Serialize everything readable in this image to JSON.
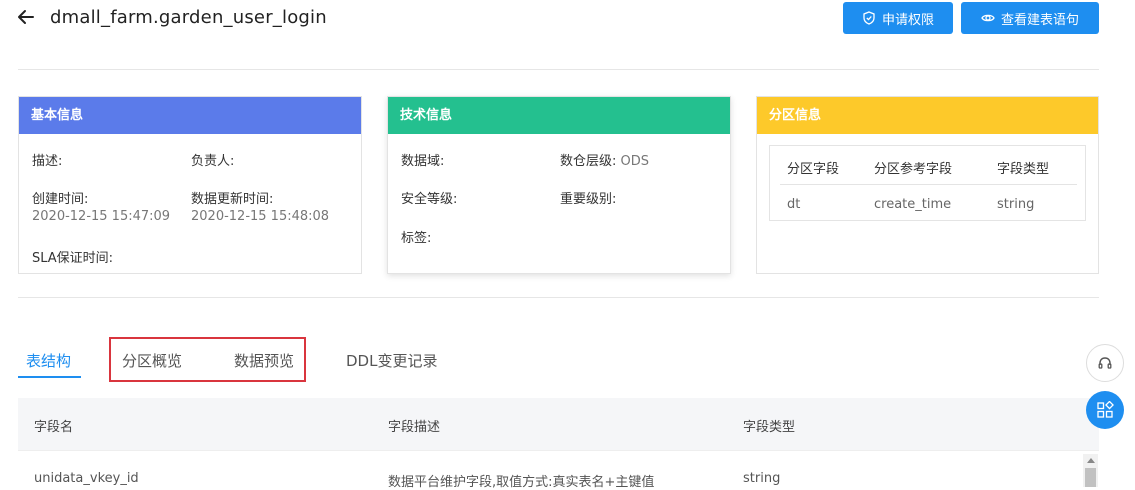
{
  "header": {
    "title": "dmall_farm.garden_user_login",
    "apply_permission_label": "申请权限",
    "view_ddl_label": "查看建表语句"
  },
  "basic_info": {
    "title": "基本信息",
    "description_label": "描述:",
    "owner_label": "负责人:",
    "created_label": "创建时间:",
    "created_value": "2020-12-15 15:47:09",
    "updated_label": "数据更新时间:",
    "updated_value": "2020-12-15 15:48:08",
    "sla_label": "SLA保证时间:"
  },
  "tech_info": {
    "title": "技术信息",
    "domain_label": "数据域:",
    "layer_label": "数仓层级:",
    "layer_value": "ODS",
    "security_label": "安全等级:",
    "importance_label": "重要级别:",
    "tags_label": "标签:"
  },
  "partition_info": {
    "title": "分区信息",
    "columns": [
      "分区字段",
      "分区参考字段",
      "字段类型"
    ],
    "rows": [
      [
        "dt",
        "create_time",
        "string"
      ]
    ]
  },
  "tabs": [
    {
      "label": "表结构",
      "active": true
    },
    {
      "label": "分区概览",
      "active": false
    },
    {
      "label": "数据预览",
      "active": false
    },
    {
      "label": "DDL变更记录",
      "active": false
    }
  ],
  "schema_table": {
    "columns": [
      "字段名",
      "字段描述",
      "字段类型"
    ],
    "rows": [
      [
        "unidata_vkey_id",
        "数据平台维护字段,取值方式:真实表名+主键值",
        "string"
      ]
    ]
  },
  "colors": {
    "accent": "#1e8ef0",
    "basic_header": "#5b7bea",
    "tech_header": "#24c08f",
    "partition_header": "#fdc92a",
    "highlight_border": "#d9353e"
  },
  "icons": [
    "back-arrow-icon",
    "shield-check-icon",
    "eye-icon",
    "headset-icon",
    "apps-grid-icon"
  ]
}
